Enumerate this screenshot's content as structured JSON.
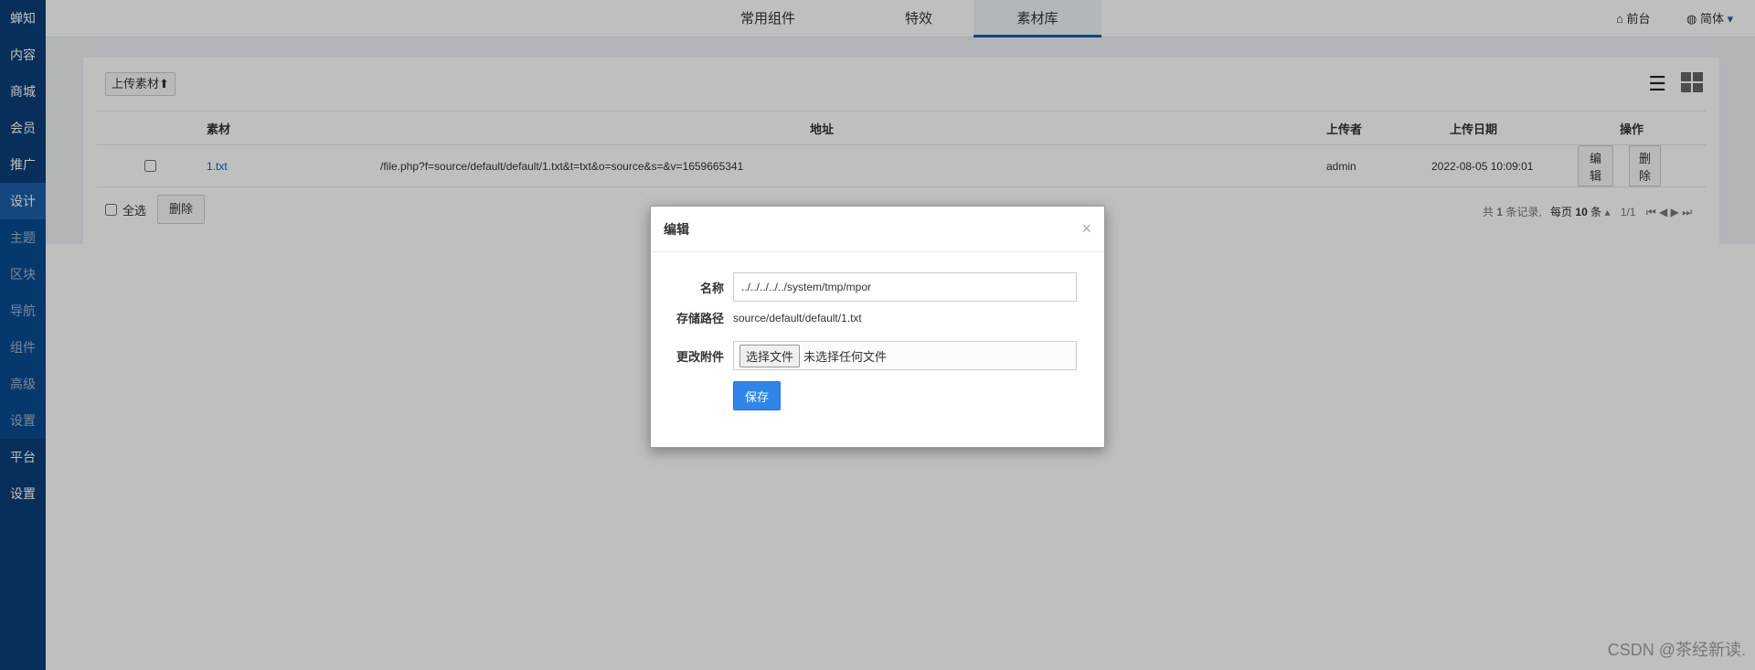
{
  "sidebar": {
    "brand": "蝉知",
    "items": [
      "内容",
      "商城",
      "会员",
      "推广"
    ],
    "active": "设计",
    "subitems": [
      "主题",
      "区块",
      "导航",
      "组件",
      "高级",
      "设置"
    ],
    "bottom": [
      "平台",
      "设置"
    ]
  },
  "topnav": {
    "tabs": [
      "常用组件",
      "特效",
      "素材库"
    ],
    "active_tab": "素材库",
    "frontend": "前台",
    "lang": "简体"
  },
  "toolbar": {
    "upload_label": "上传素材"
  },
  "table": {
    "headers": [
      "素材",
      "地址",
      "上传者",
      "上传日期",
      "操作"
    ],
    "rows": [
      {
        "name": "1.txt",
        "url": "/file.php?f=source/default/default/1.txt&t=txt&o=source&s=&v=1659665341",
        "uploader": "admin",
        "date": "2022-08-05 10:09:01",
        "edit": "编辑",
        "delete": "删除"
      }
    ]
  },
  "footer": {
    "select_all": "全选",
    "delete": "删除",
    "pager_total_prefix": "共",
    "pager_total": "1",
    "pager_total_suffix": "条记录,",
    "pager_per_page_prefix": "每页",
    "pager_per_page": "10",
    "pager_per_page_suffix": "条",
    "pager_pages": "1/1"
  },
  "modal": {
    "title": "编辑",
    "close": "×",
    "name_label": "名称",
    "name_value": "../../../../../system/tmp/mpor",
    "path_label": "存储路径",
    "path_value": "source/default/default/1.txt",
    "attach_label": "更改附件",
    "file_button": "选择文件",
    "file_status": "未选择任何文件",
    "save": "保存"
  },
  "watermark": "CSDN @茶经新读.",
  "colors": {
    "sidebar": "#0b3f79",
    "accent": "#2f86e8",
    "overlay": "rgba(0,0,0,0.25)"
  }
}
